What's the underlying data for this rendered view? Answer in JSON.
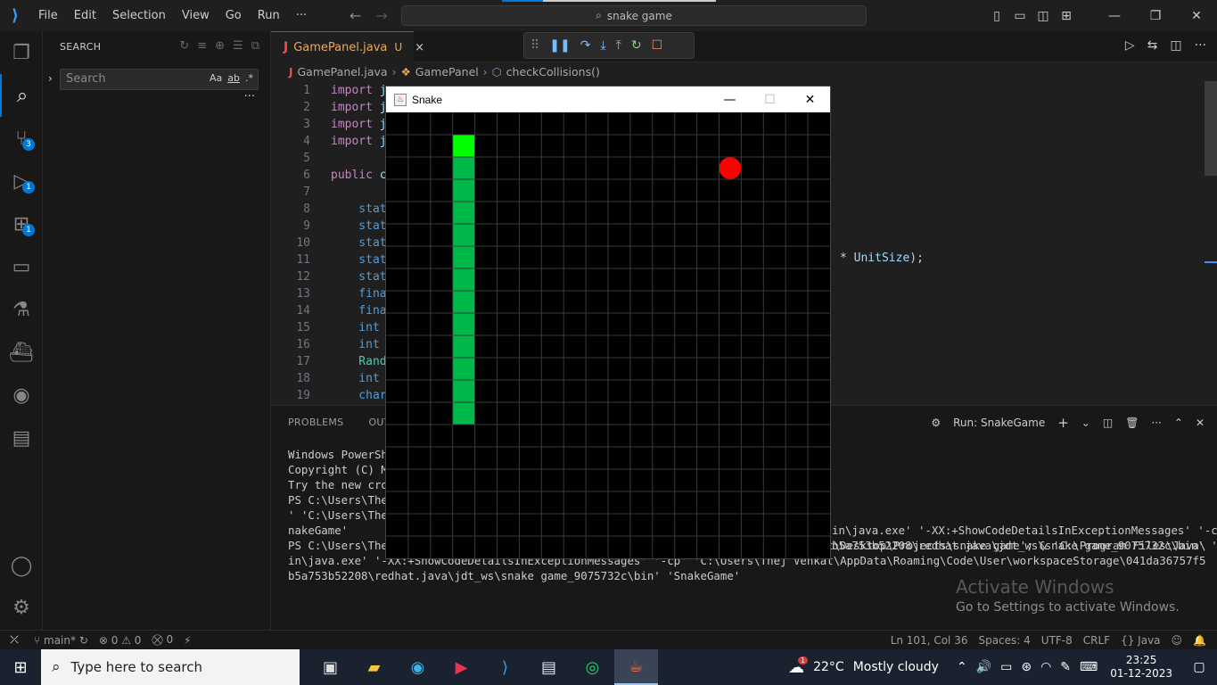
{
  "titlebar": {
    "menus": [
      "File",
      "Edit",
      "Selection",
      "View",
      "Go",
      "Run",
      "···"
    ],
    "search": "snake game",
    "logo_icon": "vscode-logo-icon"
  },
  "activity": {
    "badges": {
      "source_control": "3",
      "run_debug": "1",
      "extensions": "1"
    }
  },
  "sidebar": {
    "title": "SEARCH",
    "search_placeholder": "Search",
    "opts": [
      "Aa",
      "ab",
      ".*"
    ],
    "more": "···"
  },
  "editor": {
    "tab": {
      "icon": "J",
      "name": "GamePanel.java",
      "status": "U",
      "close": "×"
    },
    "breadcrumbs": [
      "GamePanel.java",
      "GamePanel",
      "checkCollisions()"
    ],
    "line_numbers": [
      "1",
      "2",
      "3",
      "4",
      "5",
      "6",
      "7",
      "8",
      "9",
      "10",
      "11",
      "12",
      "13",
      "14",
      "15",
      "16",
      "17",
      "18",
      "19"
    ],
    "code_lines": [
      {
        "a": "import ",
        "b": "j"
      },
      {
        "a": "import ",
        "b": "j"
      },
      {
        "a": "import ",
        "b": "j"
      },
      {
        "a": "import ",
        "b": "j"
      },
      {
        "a": "",
        "b": ""
      },
      {
        "a": "public ",
        "b": "c"
      },
      {
        "a": "",
        "b": ""
      },
      {
        "a": "    stat",
        "b": ""
      },
      {
        "a": "    stat",
        "b": ""
      },
      {
        "a": "    stat",
        "b": ""
      },
      {
        "a": "    stat",
        "b": ""
      },
      {
        "a": "    stat",
        "b": ""
      },
      {
        "a": "    fina",
        "b": ""
      },
      {
        "a": "    fina",
        "b": ""
      },
      {
        "a": "    int ",
        "b": ""
      },
      {
        "a": "    int ",
        "b": ""
      },
      {
        "a": "    Rand",
        "b": ""
      },
      {
        "a": "    int ",
        "b": ""
      },
      {
        "a": "    char",
        "b": ""
      }
    ],
    "code_tail": {
      "op": "* ",
      "var": "UnitSize",
      "end": ");"
    }
  },
  "panel": {
    "tabs": [
      "PROBLEMS",
      "OUTPU"
    ],
    "run_label": "Run: SnakeGame",
    "terminal_lines": [
      "Windows PowerShe",
      "Copyright (C) Mi",
      "",
      "Try the new cros",
      "",
      "PS C:\\Users\\Thej",
      "' 'C:\\Users\\Thej",
      "nakeGame'",
      "PS C:\\Users\\Thej Venkat\\Desktop\\Projects\\snake game>  c:; cd 'c:\\Users\\Thej Venkat\\Desktop\\Projects\\snake game'; & 'C:\\Program Files\\Java\\jdk-17\\b",
      "in\\java.exe' '-XX:+ShowCodeDetailsInExceptionMessages' '-cp' 'C:\\Users\\Thej Venkat\\AppData\\Roaming\\Code\\User\\workspaceStorage\\041da36757f58a2b7d41",
      "b5a753b52208\\redhat.java\\jdt_ws\\snake game_9075732c\\bin' 'SnakeGame'"
    ],
    "terminal_right_lines": [
      "in\\java.exe' '-XX:+ShowCodeDetailsInExceptionMessages' '-cp",
      "b5a753b52208\\redhat.java\\jdt_ws\\snake game_9075732c\\bin' 'S"
    ],
    "activate_title": "Activate Windows",
    "activate_sub": "Go to Settings to activate Windows."
  },
  "statusbar": {
    "branch": "main*",
    "errors": "0",
    "warnings": "0",
    "ports": "0",
    "position": "Ln 101, Col 36",
    "spaces": "Spaces: 4",
    "encoding": "UTF-8",
    "eol": "CRLF",
    "language": "Java"
  },
  "snake_window": {
    "title": "Snake",
    "grid_cols": 20,
    "grid_rows": 20,
    "colors": {
      "head": "#00ff00",
      "body": "#00b84a",
      "apple": "#ff0000",
      "grid": "#3a3a3a",
      "bg": "#000000"
    },
    "snake_head": [
      3,
      1
    ],
    "snake_body_col": 3,
    "snake_body_rows": [
      2,
      13
    ],
    "apple": [
      15,
      2
    ]
  },
  "taskbar": {
    "search_placeholder": "Type here to search",
    "weather_badge": "1",
    "temperature": "22°C",
    "weather": "Mostly cloudy",
    "time": "23:25",
    "date": "01-12-2023"
  }
}
